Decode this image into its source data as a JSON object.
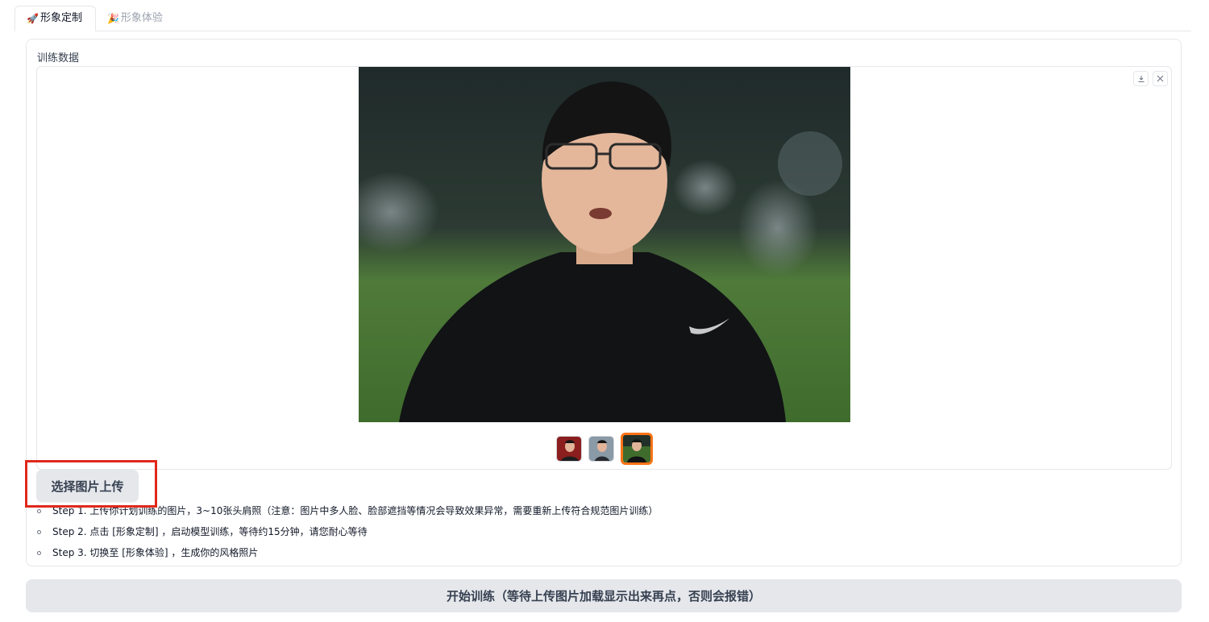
{
  "tabs": [
    {
      "emoji": "🚀",
      "label": "形象定制"
    },
    {
      "emoji": "🎉",
      "label": "形象体验"
    }
  ],
  "panel": {
    "label": "训练数据",
    "gallery": {
      "download_icon": "download-icon",
      "close_icon": "close-icon",
      "thumbnail_count": 3,
      "selected_index": 3
    },
    "upload_button": "选择图片上传",
    "steps": [
      "Step 1. 上传你计划训练的图片，3~10张头肩照（注意：图片中多人脸、脸部遮挡等情况会导致效果异常，需要重新上传符合规范图片训练）",
      "Step 2. 点击 [形象定制] ，启动模型训练，等待约15分钟，请您耐心等待",
      "Step 3. 切换至 [形象体验] ，生成你的风格照片"
    ]
  },
  "train_button": "开始训练（等待上传图片加载显示出来再点，否则会报错）",
  "colors": {
    "highlight": "#e0281c",
    "selected_thumb": "#f97316",
    "button_bg": "#e5e7eb"
  }
}
